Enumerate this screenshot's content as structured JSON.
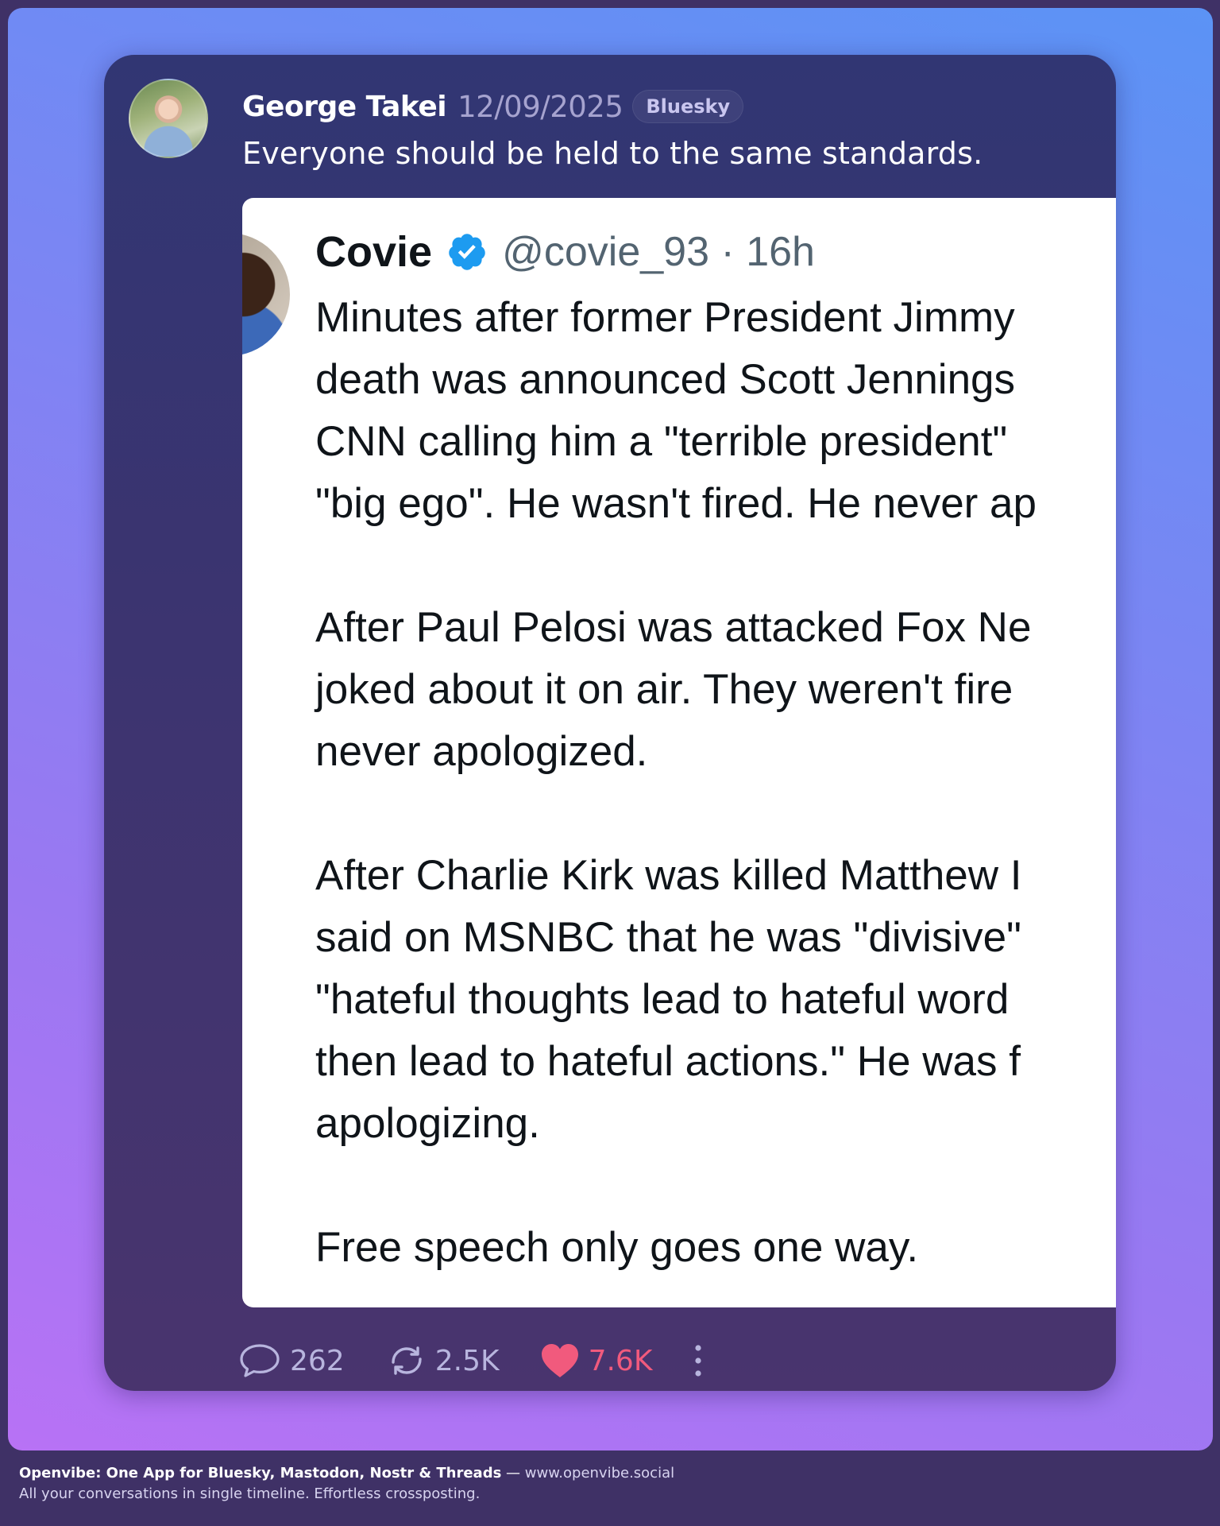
{
  "post": {
    "author": "George Takei",
    "date": "12/09/2025",
    "platform": "Bluesky",
    "text": "Everyone should be held to the same standards."
  },
  "quoted": {
    "name": "Covie",
    "handle_time": "@covie_93 · 16h",
    "body": "Minutes after former President Jimmy\ndeath was announced Scott Jennings\nCNN calling him a \"terrible president\" \n\"big ego\". He wasn't fired. He never ap\n\nAfter Paul Pelosi was attacked Fox Ne\njoked about it on air. They weren't fire\nnever apologized.\n\nAfter Charlie Kirk was killed Matthew I\nsaid on MSNBC that he was \"divisive\" \n\"hateful thoughts lead to hateful word\nthen lead to hateful actions.\" He was f\napologizing.\n\nFree speech only goes one way."
  },
  "actions": {
    "replies": "262",
    "reposts": "2.5K",
    "likes": "7.6K"
  },
  "icons": {
    "reply": "reply-icon",
    "repost": "repost-icon",
    "like": "heart-icon",
    "more": "more-vertical-icon",
    "verified": "verified-badge-icon"
  },
  "colors": {
    "like": "#f15a7d",
    "verified": "#1d9bf0"
  },
  "footer": {
    "brand": "Openvibe: One App for Bluesky, Mastodon, Nostr & Threads",
    "separator": " — ",
    "url": "www.openvibe.social",
    "tagline": "All your conversations in single timeline. Effortless crossposting."
  }
}
